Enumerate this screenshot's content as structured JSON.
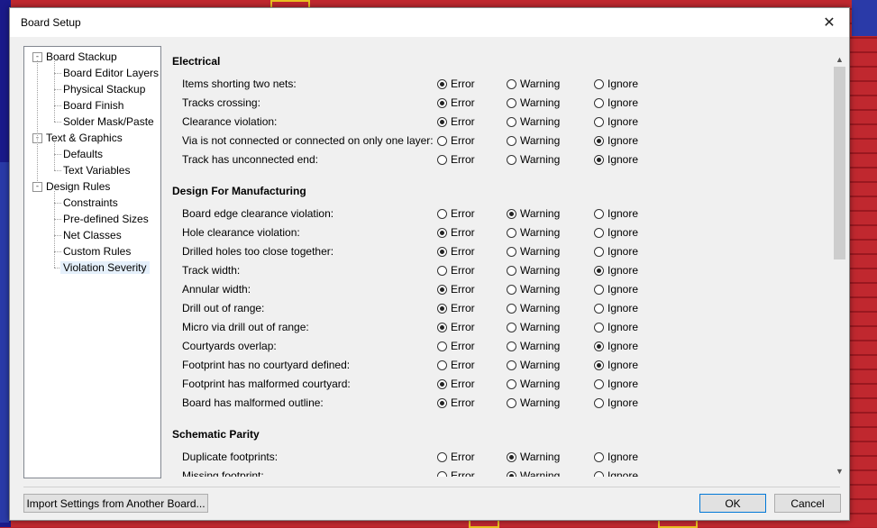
{
  "window": {
    "title": "Board Setup",
    "close_glyph": "✕"
  },
  "tree": [
    {
      "label": "Board Stackup",
      "level": 0,
      "expander": "-"
    },
    {
      "label": "Board Editor Layers",
      "level": 1
    },
    {
      "label": "Physical Stackup",
      "level": 1
    },
    {
      "label": "Board Finish",
      "level": 1
    },
    {
      "label": "Solder Mask/Paste",
      "level": 1
    },
    {
      "label": "Text & Graphics",
      "level": 0,
      "expander": "-"
    },
    {
      "label": "Defaults",
      "level": 1
    },
    {
      "label": "Text Variables",
      "level": 1
    },
    {
      "label": "Design Rules",
      "level": 0,
      "expander": "-"
    },
    {
      "label": "Constraints",
      "level": 1
    },
    {
      "label": "Pre-defined Sizes",
      "level": 1
    },
    {
      "label": "Net Classes",
      "level": 1
    },
    {
      "label": "Custom Rules",
      "level": 1
    },
    {
      "label": "Violation Severity",
      "level": 1,
      "selected": true
    }
  ],
  "options": {
    "error": "Error",
    "warning": "Warning",
    "ignore": "Ignore"
  },
  "sections": [
    {
      "title": "Electrical",
      "rules": [
        {
          "label": "Items shorting two nets:",
          "value": "error"
        },
        {
          "label": "Tracks crossing:",
          "value": "error"
        },
        {
          "label": "Clearance violation:",
          "value": "error"
        },
        {
          "label": "Via is not connected or connected on only one layer:",
          "value": "ignore"
        },
        {
          "label": "Track has unconnected end:",
          "value": "ignore"
        }
      ]
    },
    {
      "title": "Design For Manufacturing",
      "rules": [
        {
          "label": "Board edge clearance violation:",
          "value": "warning"
        },
        {
          "label": "Hole clearance violation:",
          "value": "error"
        },
        {
          "label": "Drilled holes too close together:",
          "value": "error"
        },
        {
          "label": "Track width:",
          "value": "ignore"
        },
        {
          "label": "Annular width:",
          "value": "error"
        },
        {
          "label": "Drill out of range:",
          "value": "error"
        },
        {
          "label": "Micro via drill out of range:",
          "value": "error"
        },
        {
          "label": "Courtyards overlap:",
          "value": "ignore"
        },
        {
          "label": "Footprint has no courtyard defined:",
          "value": "ignore"
        },
        {
          "label": "Footprint has malformed courtyard:",
          "value": "error"
        },
        {
          "label": "Board has malformed outline:",
          "value": "error"
        }
      ]
    },
    {
      "title": "Schematic Parity",
      "rules": [
        {
          "label": "Duplicate footprints:",
          "value": "warning"
        },
        {
          "label": "Missing footprint:",
          "value": "warning"
        }
      ]
    }
  ],
  "buttons": {
    "import": "Import Settings from Another Board...",
    "ok": "OK",
    "cancel": "Cancel"
  },
  "scrollbar": {
    "up_glyph": "▲",
    "down_glyph": "▼"
  }
}
